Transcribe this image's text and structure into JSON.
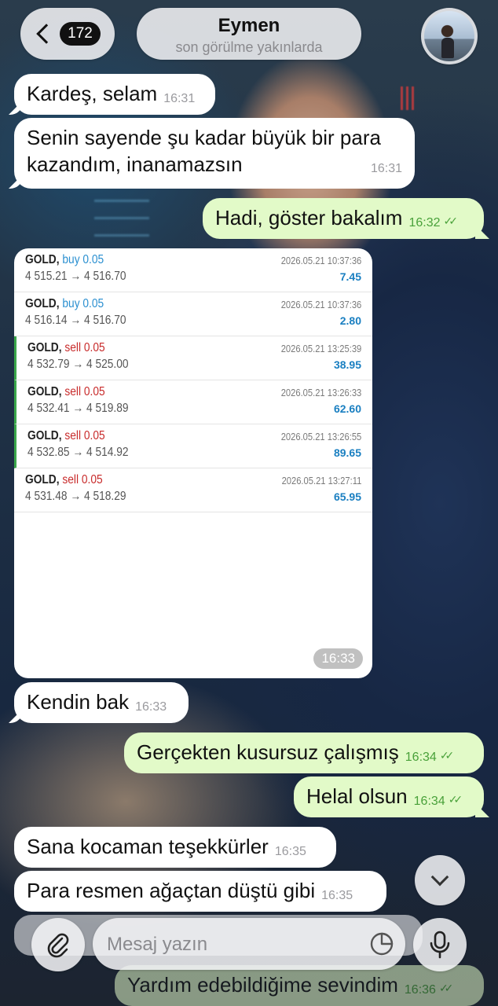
{
  "header": {
    "back_count": "172",
    "contact_name": "Eymen",
    "contact_status": "son görülme yakınlarda"
  },
  "messages": [
    {
      "text": "Kardeş, selam",
      "time": "16:31",
      "dir": "in"
    },
    {
      "text_line1": "Senin sayende şu kadar büyük bir para",
      "text_line2": "kazandım, inanamazsın",
      "time": "16:31",
      "dir": "in"
    },
    {
      "text": "Hadi, göster bakalım",
      "time": "16:32",
      "dir": "out",
      "read": true
    },
    {
      "text": "Kendin bak",
      "time": "16:33",
      "dir": "in"
    },
    {
      "text": "Gerçekten kusursuz çalışmış",
      "time": "16:34",
      "dir": "out",
      "read": true
    },
    {
      "text": "Helal olsun",
      "time": "16:34",
      "dir": "out",
      "read": true
    },
    {
      "text": "Sana kocaman teşekkürler",
      "time": "16:35",
      "dir": "in"
    },
    {
      "text": "Para resmen ağaçtan düştü gibi",
      "time": "16:35",
      "dir": "in"
    },
    {
      "text": "Yardım edebildiğime sevindim",
      "time": "16:36",
      "dir": "out",
      "read": true
    }
  ],
  "trade_card": {
    "time": "16:33",
    "trades": [
      {
        "symbol": "GOLD",
        "side": "buy 0.05",
        "prices": "4 515.21 → 4 516.70",
        "date": "2026.05.21 10:37:36",
        "profit": "7.45"
      },
      {
        "symbol": "GOLD",
        "side": "buy 0.05",
        "prices": "4 516.14 → 4 516.70",
        "date": "2026.05.21 10:37:36",
        "profit": "2.80"
      },
      {
        "symbol": "GOLD",
        "side": "sell 0.05",
        "prices": "4 532.79 → 4 525.00",
        "date": "2026.05.21 13:25:39",
        "profit": "38.95"
      },
      {
        "symbol": "GOLD",
        "side": "sell 0.05",
        "prices": "4 532.41 → 4 519.89",
        "date": "2026.05.21 13:26:33",
        "profit": "62.60"
      },
      {
        "symbol": "GOLD",
        "side": "sell 0.05",
        "prices": "4 532.85 → 4 514.92",
        "date": "2026.05.21 13:26:55",
        "profit": "89.65"
      },
      {
        "symbol": "GOLD",
        "side": "sell 0.05",
        "prices": "4 531.48 → 4 518.29",
        "date": "2026.05.21 13:27:11",
        "profit": "65.95"
      }
    ]
  },
  "composer": {
    "placeholder": "Mesaj yazın"
  },
  "icons": {
    "back": "chevron-left-icon",
    "attach": "paperclip-icon",
    "sticker": "sticker-icon",
    "mic": "microphone-icon",
    "scroll": "chevron-down-icon"
  },
  "colors": {
    "outgoing_bubble": "#e2fac8",
    "incoming_bubble": "#ffffff",
    "buy": "#2a8fd0",
    "sell": "#c82a2a",
    "profit": "#1a7fc1",
    "read_ticks": "#49a13a"
  }
}
